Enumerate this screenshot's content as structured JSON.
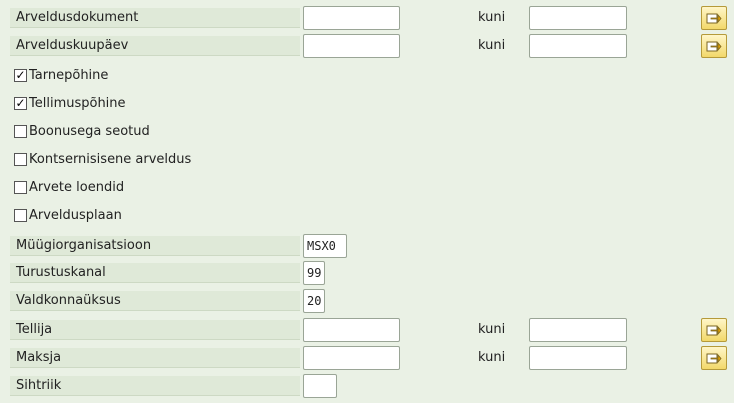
{
  "form": {
    "billing_document": {
      "label": "Arveldusdokument",
      "value": "",
      "to_label": "kuni",
      "to_value": ""
    },
    "billing_date": {
      "label": "Arvelduskuupäev",
      "value": "",
      "to_label": "kuni",
      "to_value": ""
    },
    "checkboxes": [
      {
        "label": "Tarnepõhine",
        "checked": true,
        "mark": "✓"
      },
      {
        "label": "Tellimuspõhine",
        "checked": true,
        "mark": "✓"
      },
      {
        "label": "Boonusega seotud",
        "checked": false,
        "mark": ""
      },
      {
        "label": "Kontsernisisene arveldus",
        "checked": false,
        "mark": ""
      },
      {
        "label": "Arvete loendid",
        "checked": false,
        "mark": ""
      },
      {
        "label": "Arveldusplaan",
        "checked": false,
        "mark": ""
      }
    ],
    "sales_org": {
      "label": "Müügiorganisatsioon",
      "value": "MSX0"
    },
    "distribution_channel": {
      "label": "Turustuskanal",
      "value": "99"
    },
    "division": {
      "label": "Valdkonnaüksus",
      "value": "20"
    },
    "sold_to": {
      "label": "Tellija",
      "value": "",
      "to_label": "kuni",
      "to_value": ""
    },
    "payer": {
      "label": "Maksja",
      "value": "",
      "to_label": "kuni",
      "to_value": ""
    },
    "destination_country": {
      "label": "Sihtriik",
      "value": ""
    }
  },
  "colors": {
    "background": "#eaf1e5",
    "label_bg": "#dfe9d8",
    "button_yellow": "#f2d86a"
  },
  "icons": {
    "multiple_selection": "arrow-right-icon"
  }
}
